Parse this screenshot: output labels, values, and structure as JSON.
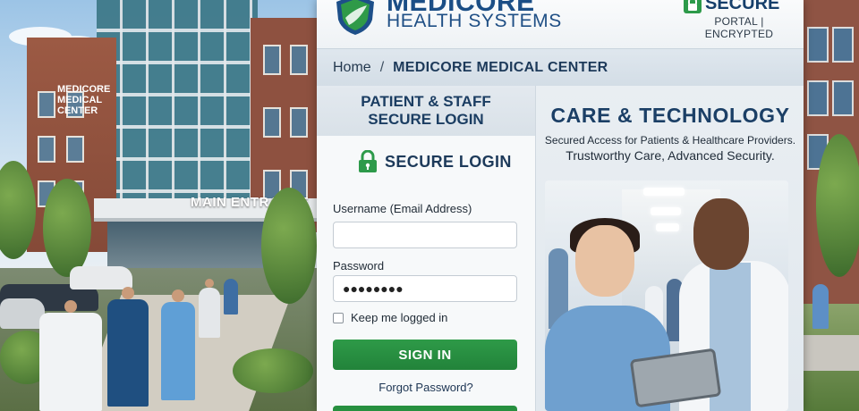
{
  "background": {
    "building_sign": "MEDICORE MEDICAL CENTER",
    "entrance_sign": "MAIN ENTRANCE"
  },
  "header": {
    "brand_name": "MEDICORE",
    "brand_sub": "HEALTH SYSTEMS",
    "secure_title": "SECURE",
    "secure_sub": "PORTAL | ENCRYPTED"
  },
  "breadcrumb": {
    "home": "Home",
    "separator": "/",
    "current": "MEDICORE MEDICAL CENTER"
  },
  "login": {
    "heading_line1": "PATIENT & STAFF",
    "heading_line2": "SECURE LOGIN",
    "title": "SECURE LOGIN",
    "username_label": "Username (Email Address)",
    "username_value": "",
    "password_label": "Password",
    "password_value": "●●●●●●●●",
    "remember_label": "Keep me logged in",
    "signin_label": "SIGN IN",
    "forgot_label": "Forgot Password?"
  },
  "info": {
    "title": "CARE & TECHNOLOGY",
    "subtitle1": "Secured Access for Patients & Healthcare Providers.",
    "subtitle2": "Trustworthy Care, Advanced Security."
  },
  "colors": {
    "brand_blue": "#1b4e86",
    "accent_green": "#27903f",
    "panel_bg": "#f0f4f7"
  },
  "icons": {
    "logo": "shield-logo-icon",
    "secure": "lock-icon",
    "login": "lock-icon"
  }
}
